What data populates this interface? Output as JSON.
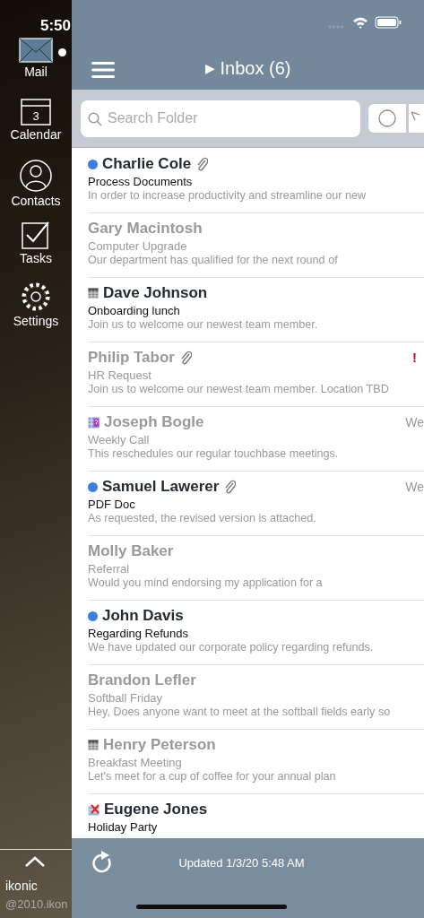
{
  "status_bar": {
    "time": "5:50"
  },
  "sidebar": {
    "items": [
      {
        "label": "Mail",
        "kind": "mail",
        "selected": true
      },
      {
        "label": "Calendar",
        "kind": "calendar",
        "badge": "3",
        "selected": false
      },
      {
        "label": "Contacts",
        "kind": "contacts",
        "selected": false
      },
      {
        "label": "Tasks",
        "kind": "tasks",
        "selected": false
      },
      {
        "label": "Settings",
        "kind": "settings",
        "selected": false
      }
    ],
    "footer": {
      "title": "ikonic",
      "subtitle": "@2010.ikon"
    }
  },
  "header": {
    "expander": "▶",
    "title": "Inbox (6)"
  },
  "search": {
    "placeholder": "Search Folder"
  },
  "messages": [
    {
      "sender": "Charlie Cole",
      "subject": "Process Documents",
      "preview": "In order to increase productivity and streamline our new",
      "unread": true,
      "kind": "dot",
      "attachment": true
    },
    {
      "sender": "Gary Macintosh",
      "subject": "Computer Upgrade",
      "preview": "Our department has qualified for the next round of",
      "unread": false,
      "attachment": false
    },
    {
      "sender": "Dave Johnson",
      "subject": "Onboarding lunch",
      "preview": "Join us to welcome our newest team member.",
      "unread": true,
      "kind": "calendar",
      "attachment": false
    },
    {
      "sender": "Philip Tabor",
      "subject": "HR Request",
      "preview": "Join us to welcome our newest team member. Location TBD",
      "unread": false,
      "attachment": true,
      "priority": "!"
    },
    {
      "sender": "Joseph Bogle",
      "subject": "Weekly Call",
      "preview": "This reschedules our regular touchbase meetings.",
      "unread": false,
      "kind": "meeting",
      "attachment": false,
      "date": "We"
    },
    {
      "sender": "Samuel Lawerer",
      "subject": "PDF Doc",
      "preview": "As requested, the revised version is attached.",
      "unread": true,
      "kind": "dot",
      "attachment": true,
      "date": "We"
    },
    {
      "sender": "Molly Baker",
      "subject": "Referral",
      "preview": "Would you mind endorsing my application for a",
      "unread": false,
      "attachment": false
    },
    {
      "sender": "John Davis",
      "subject": "Regarding Refunds",
      "preview": "We have updated our corporate policy regarding refunds.",
      "unread": true,
      "kind": "dot",
      "attachment": false
    },
    {
      "sender": "Brandon Lefler",
      "subject": "Softball Friday",
      "preview": "Hey, Does anyone want to meet at the softball fields early so",
      "unread": false,
      "attachment": false
    },
    {
      "sender": "Henry Peterson",
      "subject": "Breakfast Meeting",
      "preview": "Let's meet for a cup of coffee for your annual plan",
      "unread": false,
      "kind": "calendar",
      "attachment": false
    },
    {
      "sender": "Eugene Jones",
      "subject": "Holiday Party",
      "unread": true,
      "kind": "cancelled",
      "attachment": false
    }
  ],
  "footer": {
    "status": "Updated 1/3/20 5:48 AM"
  }
}
